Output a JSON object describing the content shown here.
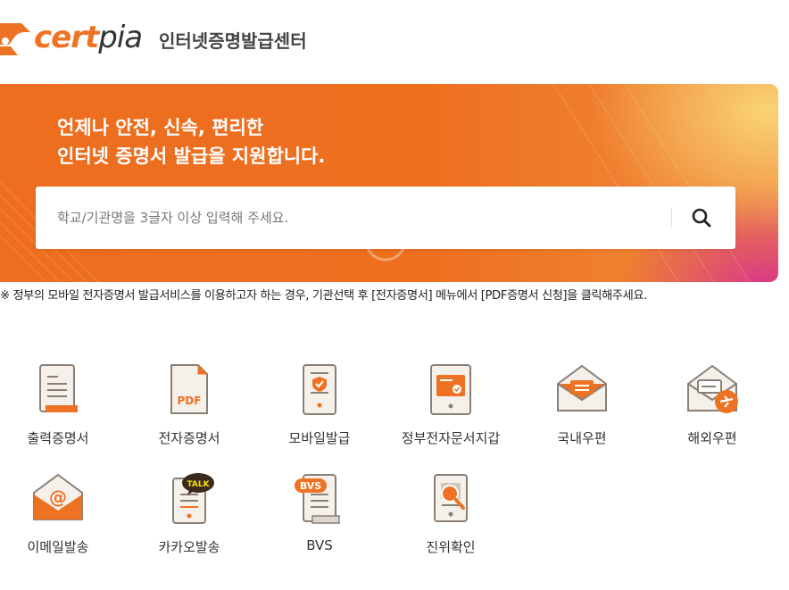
{
  "header": {
    "logo_part1": "cert",
    "logo_part2": "pia",
    "site_title": "인터넷증명발급센터"
  },
  "hero": {
    "line1": "언제나 안전, 신속, 편리한",
    "line2": "인터넷 증명서 발급을 지원합니다."
  },
  "search": {
    "placeholder": "학교/기관명을 3글자 이상 입력해 주세요.",
    "button_icon": "search-icon"
  },
  "notice": "※ 정부의 모바일 전자증명서 발급서비스를 이용하고자 하는 경우, 기관선택 후 [전자증명서] 메뉴에서 [PDF증명서 신청]을 클릭해주세요.",
  "menu": [
    {
      "label": "출력증명서",
      "icon": "printed-document-icon"
    },
    {
      "label": "전자증명서",
      "icon": "pdf-document-icon",
      "badge": "PDF"
    },
    {
      "label": "모바일발급",
      "icon": "mobile-certificate-icon"
    },
    {
      "label": "정부전자문서지갑",
      "icon": "e-document-wallet-icon"
    },
    {
      "label": "국내우편",
      "icon": "domestic-mail-icon"
    },
    {
      "label": "해외우편",
      "icon": "international-mail-icon"
    },
    {
      "label": "이메일발송",
      "icon": "email-icon",
      "badge": "@"
    },
    {
      "label": "카카오발송",
      "icon": "kakao-talk-icon",
      "badge": "TALK"
    },
    {
      "label": "BVS",
      "icon": "bvs-document-icon",
      "badge": "BVS"
    },
    {
      "label": "진위확인",
      "icon": "authenticity-check-icon"
    }
  ],
  "colors": {
    "accent": "#ee7223",
    "icon_fill": "#f5f0ea",
    "icon_stroke": "#8a7f76"
  }
}
